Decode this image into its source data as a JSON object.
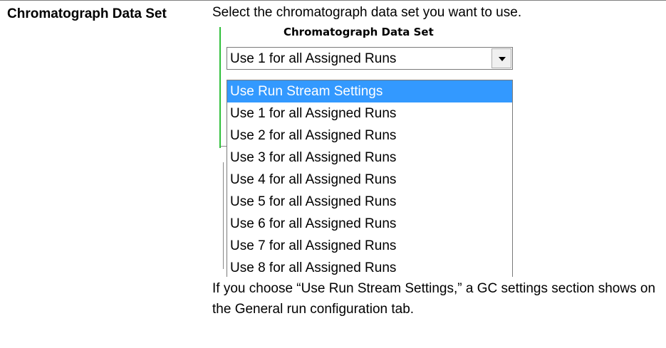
{
  "term": "Chromatograph Data Set",
  "intro": "Select the chromatograph data set you want to use.",
  "control": {
    "label": "Chromatograph Data Set",
    "selected_value": "Use 1 for all Assigned Runs",
    "options": [
      "Use Run Stream Settings",
      "Use 1 for all Assigned Runs",
      "Use 2 for all Assigned Runs",
      "Use 3 for all Assigned Runs",
      "Use 4 for all Assigned Runs",
      "Use 5 for all Assigned Runs",
      "Use 6 for all Assigned Runs",
      "Use 7 for all Assigned Runs",
      "Use 8 for all Assigned Runs"
    ],
    "highlighted_index": 0,
    "highlight_color": "#3399ff"
  },
  "note": "If you choose “Use Run Stream Settings,” a GC settings section shows on the General run configuration tab."
}
